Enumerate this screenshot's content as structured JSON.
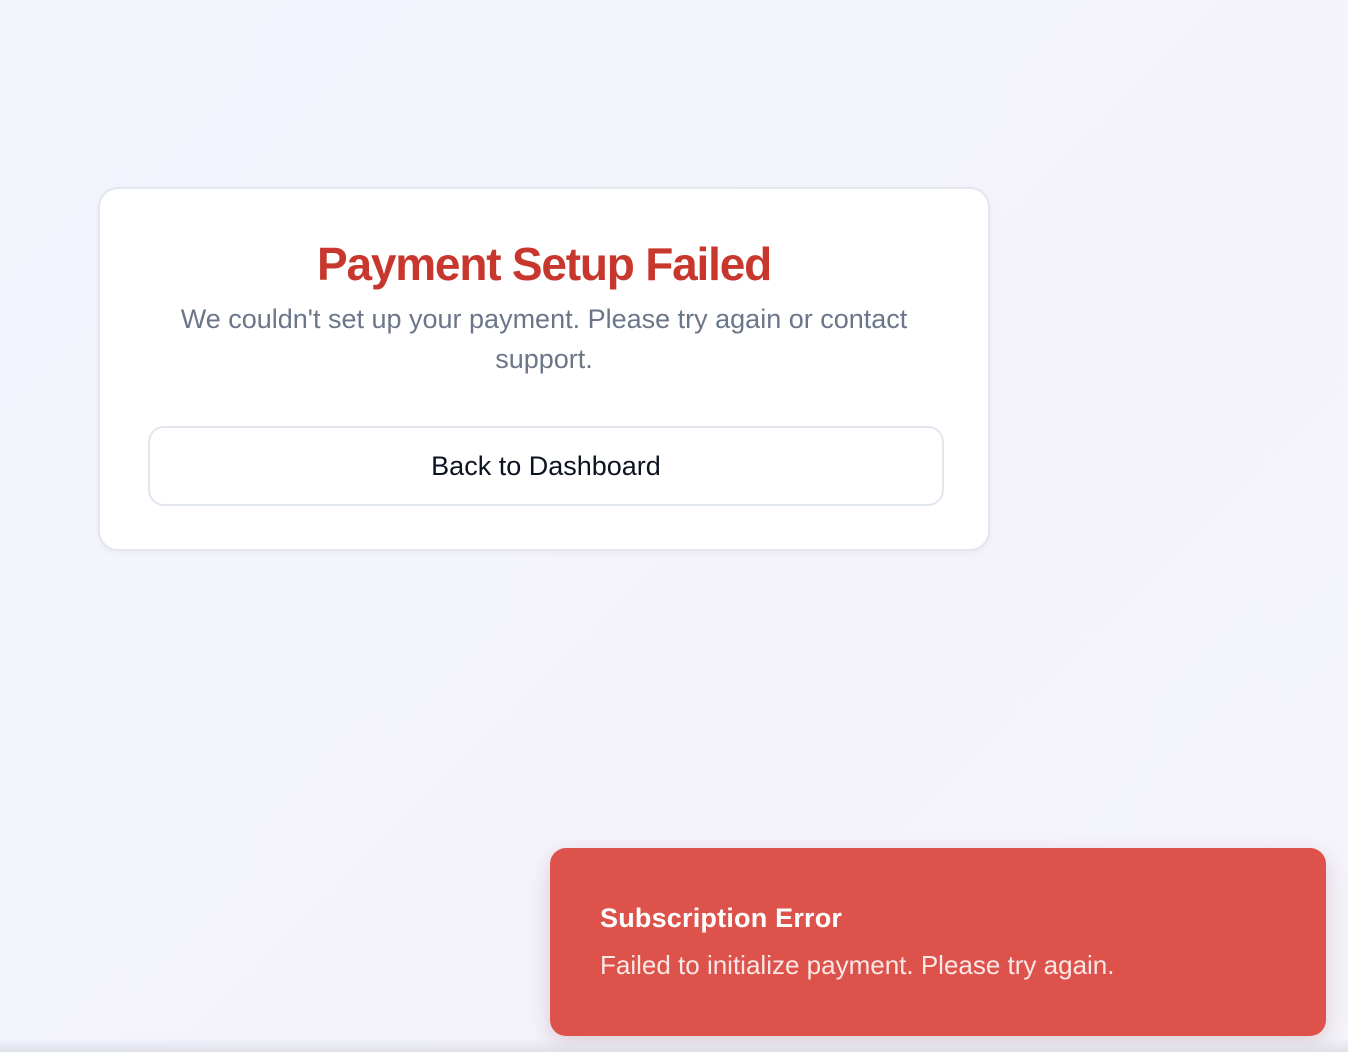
{
  "card": {
    "title": "Payment Setup Failed",
    "description": "We couldn't set up your payment. Please try again or contact support.",
    "back_button_label": "Back to Dashboard"
  },
  "toast": {
    "title": "Subscription Error",
    "message": "Failed to initialize payment. Please try again."
  },
  "colors": {
    "error_title": "#c8372d",
    "toast_background": "#dd524b",
    "muted_text": "#6b7689",
    "border": "#e2e6ef"
  }
}
